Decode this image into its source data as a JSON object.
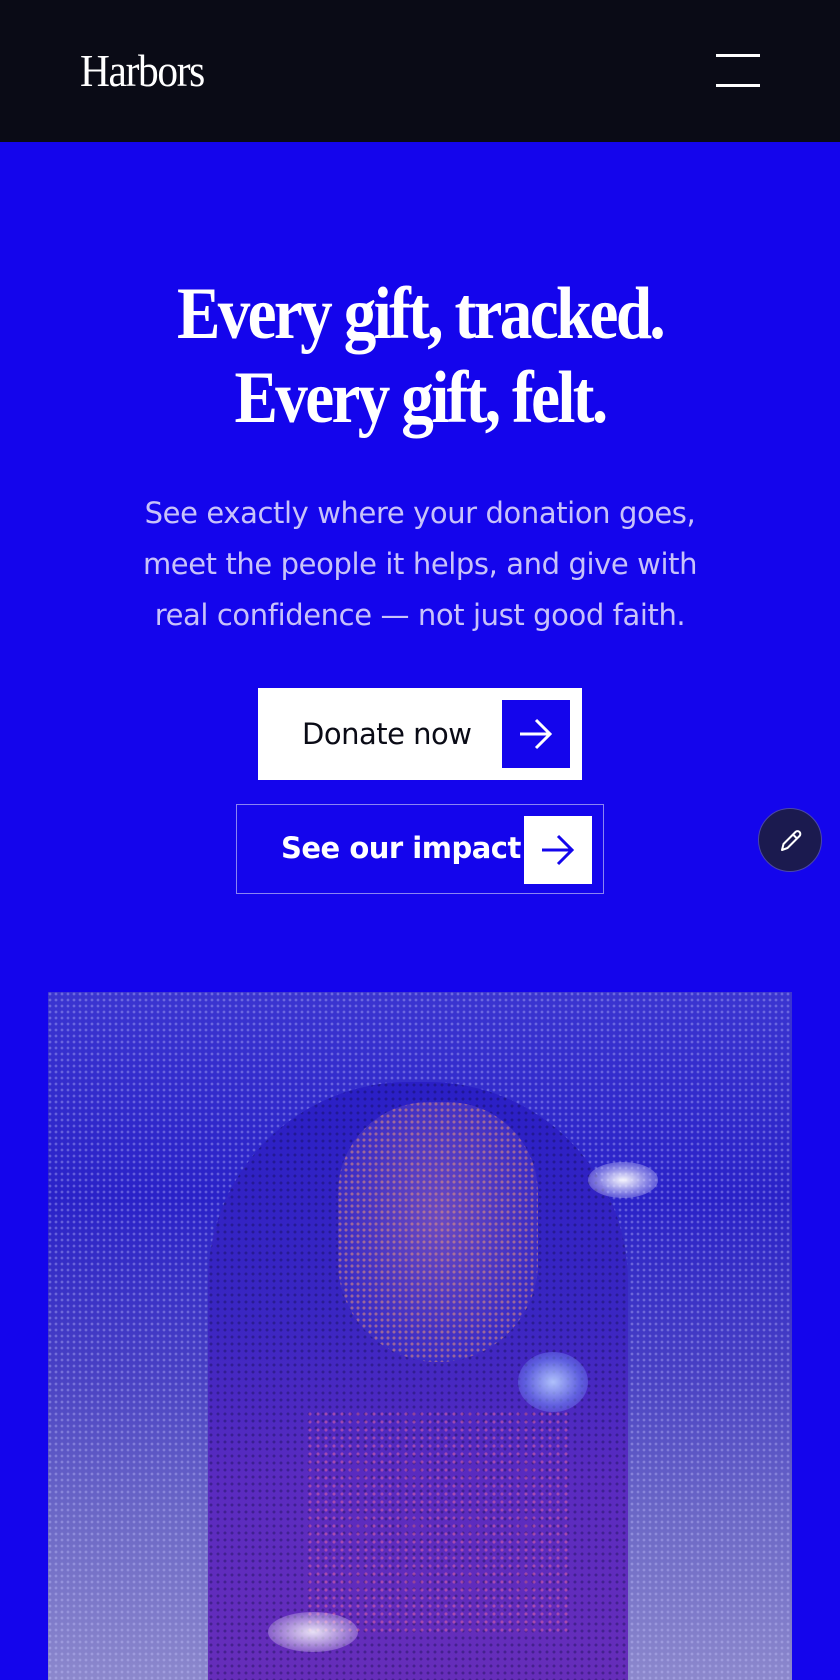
{
  "header": {
    "logo": "Harbors",
    "menu_icon": "hamburger-menu-icon"
  },
  "hero": {
    "headline_line1": "Every gift, tracked.",
    "headline_line2": "Every gift, felt.",
    "subtext": "See exactly where your donation goes, meet the people it helps, and give with real confidence — not just good faith.",
    "primary_button": {
      "label": "Donate now",
      "icon": "arrow-right-icon"
    },
    "secondary_button": {
      "label": "See our impact",
      "icon": "arrow-right-icon"
    },
    "image_icon": "portrait-photo"
  },
  "edit_button": {
    "icon": "pencil-icon"
  },
  "colors": {
    "brand_blue": "#1405EC",
    "header_bg": "#0A0B16",
    "white": "#FFFFFF",
    "subtext": "#C8C2FA"
  }
}
